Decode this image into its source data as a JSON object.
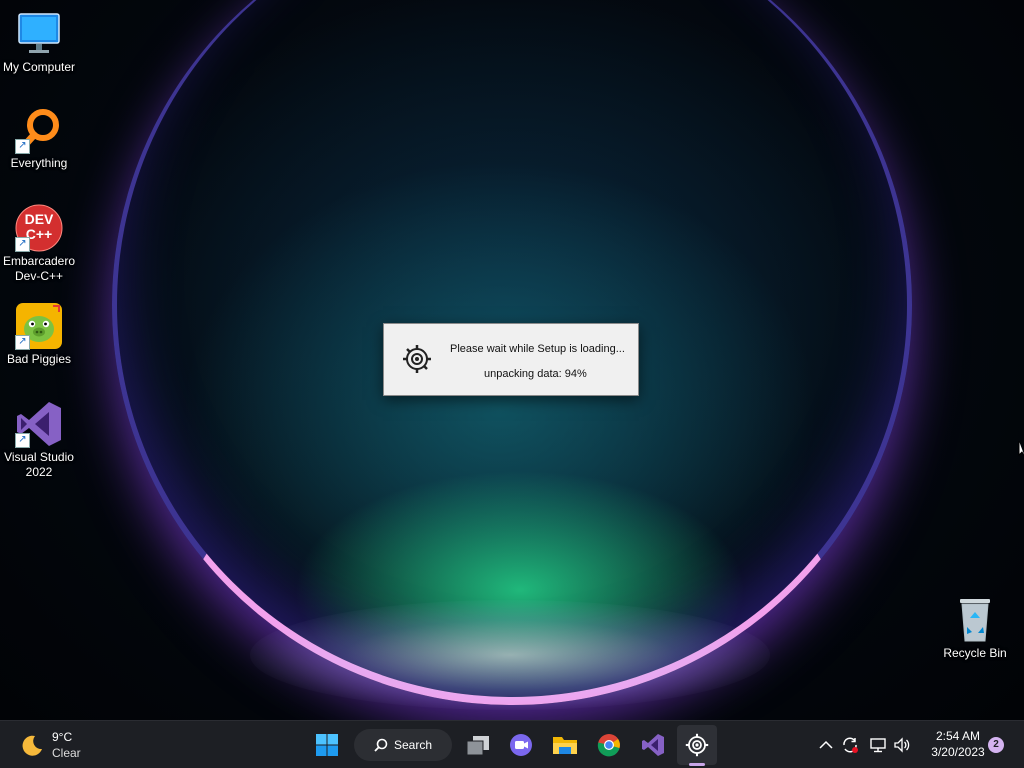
{
  "desktop": {
    "icons": [
      {
        "label": "My Computer",
        "icon": "monitor-icon"
      },
      {
        "label": "Everything",
        "icon": "magnifier-icon"
      },
      {
        "label": "Embarcadero Dev-C++",
        "icon": "devcpp-icon",
        "badge": "DEV C++"
      },
      {
        "label": "Bad Piggies",
        "icon": "bad-piggies-icon"
      },
      {
        "label": "Visual Studio 2022",
        "icon": "visual-studio-icon"
      },
      {
        "label": "Recycle Bin",
        "icon": "recycle-bin-icon"
      }
    ]
  },
  "dialog": {
    "message": "Please wait while Setup is loading...",
    "status": "unpacking data: 94%",
    "progress_percent": 94,
    "icon": "steelseries-gear-icon"
  },
  "taskbar": {
    "weather": {
      "temperature": "9°C",
      "condition": "Clear",
      "icon": "moon-icon"
    },
    "search_label": "Search",
    "apps": [
      "start-icon",
      "task-view-icon",
      "teams-chat-icon",
      "file-explorer-icon",
      "chrome-icon",
      "visual-studio-icon",
      "steelseries-icon"
    ],
    "tray": [
      "chevron-up-icon",
      "sync-icon",
      "network-icon",
      "volume-icon"
    ],
    "time": "2:54 AM",
    "date": "3/20/2023",
    "notification_count": "2"
  },
  "colors": {
    "taskbar_bg": "#1d1f24",
    "dialog_bg": "#f0f0f0",
    "accent": "#c9a6e8"
  }
}
